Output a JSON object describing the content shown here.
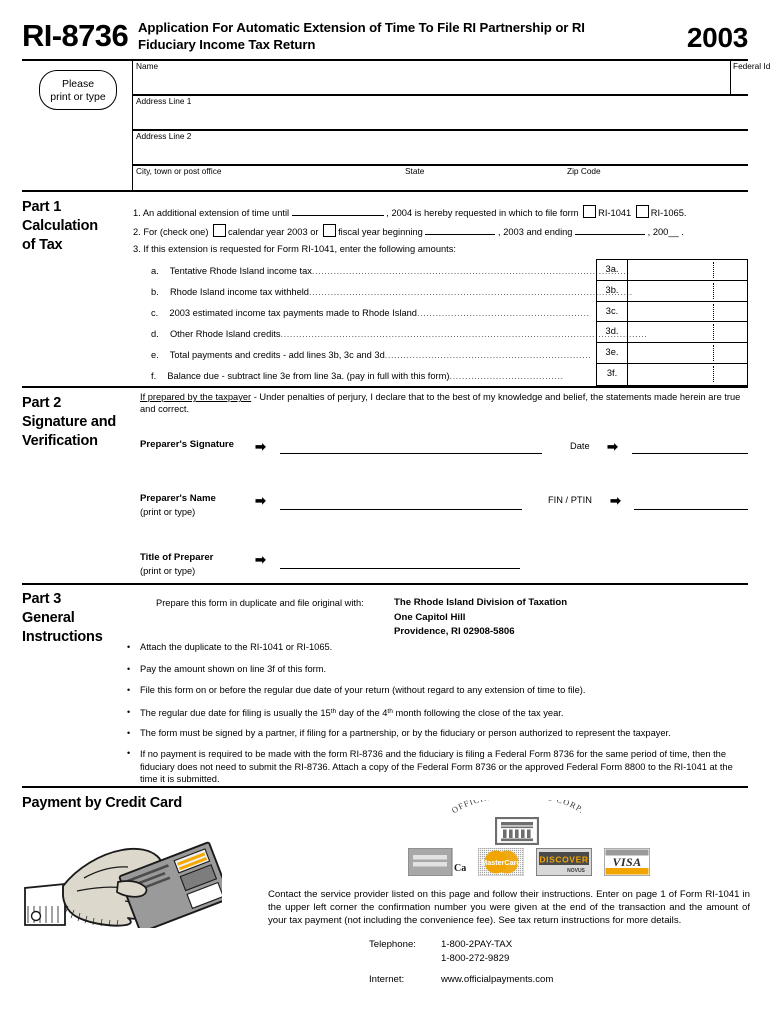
{
  "header": {
    "form_number": "RI-8736",
    "title_line1": "Application For Automatic Extension of Time To File RI Partnership",
    "title_line2": "or RI Fiduciary Income Tax Return",
    "year": "2003"
  },
  "taxpayer_block": {
    "please_print_line1": "Please",
    "please_print_line2": "print or type",
    "name_label": "Name",
    "fein_label": "Federal Identification Number",
    "address1_label": "Address Line 1",
    "address2_label": "Address Line 2",
    "city_label": "City, town or post office",
    "state_label": "State",
    "zip_label": "Zip Code",
    "name_value": "",
    "fein_value": "",
    "address1_value": "",
    "address2_value": "",
    "city_value": "",
    "state_value": "",
    "zip_value": ""
  },
  "part1": {
    "heading_line1": "Part 1",
    "heading_line2": "Calculation",
    "heading_line3": "of Tax",
    "line1": {
      "prefix": "1. An additional extension of time until",
      "mid": ", 2004 is hereby requested in which to file form",
      "option1": "RI-1041",
      "option2": "RI-1065.",
      "date_value": ""
    },
    "line2": {
      "prefix": "2. For (check one)",
      "option1": "calendar year 2003 or",
      "option2": "fiscal year beginning",
      "mid": ", 2003 and ending",
      "suffix": ", 200__ .",
      "begin_value": "",
      "end_value": ""
    },
    "line3_intro": "3. If this extension is requested for Form RI-1041, enter the following amounts:",
    "rows": [
      {
        "letter": "a.",
        "text": "Tentative Rhode Island income tax",
        "no": "3a.",
        "amount": "",
        "cents": ""
      },
      {
        "letter": "b.",
        "text": "Rhode Island income tax withheld",
        "no": "3b.",
        "amount": "",
        "cents": ""
      },
      {
        "letter": "c.",
        "text": "2003 estimated income tax payments made to Rhode Island",
        "no": "3c.",
        "amount": "",
        "cents": ""
      },
      {
        "letter": "d.",
        "text": "Other Rhode Island credits",
        "no": "3d.",
        "amount": "",
        "cents": ""
      },
      {
        "letter": "e.",
        "text": "Total payments and credits - add lines 3b, 3c and 3d",
        "no": "3e.",
        "amount": "",
        "cents": ""
      },
      {
        "letter": "f.",
        "text": "Balance due - subtract line 3e from line 3a. (pay in full with this form)",
        "no": "3f.",
        "amount": "",
        "cents": ""
      }
    ]
  },
  "part2": {
    "heading_line1": "Part 2",
    "heading_line2": "Signature and",
    "heading_line3": "Verification",
    "declaration_underlined": "If prepared by the taxpayer",
    "declaration_rest": " - Under penalties of perjury, I declare that to the best of my knowledge and belief, the statements made herein are true and correct.",
    "preparer_signature_label": "Preparer's Signature",
    "date_label": "Date",
    "preparer_name_label": "Preparer's Name",
    "preparer_name_sub": "(print or type)",
    "fin_ptin_label": "FIN / PTIN",
    "title_of_preparer_label": "Title of Preparer",
    "title_of_preparer_sub": "(print or type)",
    "preparer_signature_value": "",
    "date_value": "",
    "preparer_name_value": "",
    "fin_ptin_value": "",
    "title_of_preparer_value": ""
  },
  "part3": {
    "heading_line1": "Part 3",
    "heading_line2": "General",
    "heading_line3": "Instructions",
    "file_with_label": "Prepare this form in duplicate and file original with:",
    "agency_line1": "The Rhode Island Division of Taxation",
    "agency_line2": "One Capitol Hill",
    "agency_line3": "Providence, RI  02908-5806",
    "bullets": [
      "Attach the duplicate to the RI-1041 or RI-1065.",
      "Pay the amount shown on line 3f of this form.",
      "File this form on or before the regular due date of your return (without regard to any extension of time to file).",
      "The regular due date for filing is usually the 15th day of the 4th month following the close of the tax year.",
      "The form must be signed by a partner, if filing for a partnership, or by the fiduciary or person authorized to represent the taxpayer.",
      "If no payment is required to be made with the form RI-8736 and the fiduciary is filing a Federal Form 8736 for the same period of time, then the fiduciary does not need to submit the RI-8736.  Attach a copy of the Federal Form 8736 or the approved Federal Form 8800 to the RI-1041 at the time it is submitted."
    ],
    "bullet5_parts": {
      "a": "The regular due date for filing is usually the 15",
      "sup1": "th",
      "b": " day of the 4",
      "sup2": "th",
      "c": " month following the close of the tax year."
    }
  },
  "payment": {
    "section_title": "Payment by Credit Card",
    "provider_name": "OFFICIAL PAYMENTS CORP.",
    "cards": [
      {
        "name": "american-express",
        "label": "Cards"
      },
      {
        "name": "mastercard",
        "label": "MasterCard"
      },
      {
        "name": "discover",
        "label": "DISCOVER"
      },
      {
        "name": "visa",
        "label": "VISA"
      }
    ],
    "amex_suffix": "Cards",
    "contact_text": "Contact the service provider listed on this page and follow their instructions.  Enter on page 1 of Form RI-1041 in the upper left corner the confirmation number you were given at the end of the transaction and the amount of your tax payment (not including the convenience fee).  See tax return instructions for more details.",
    "telephone_label": "Telephone:",
    "telephone_value1": "1-800-2PAY-TAX",
    "telephone_value2": "1-800-272-9829",
    "internet_label": "Internet:",
    "internet_value": "www.officialpayments.com"
  },
  "colors": {
    "ink": "#000000",
    "paper": "#ffffff",
    "card_gray": "#8c8c8c",
    "card_gold": "#f5a800",
    "skin": "#ddd8cc"
  }
}
